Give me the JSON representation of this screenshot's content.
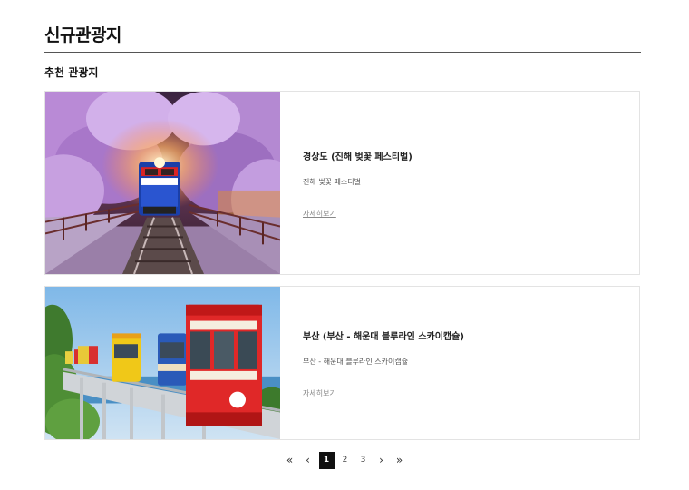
{
  "page": {
    "title": "신규관광지",
    "section_title": "추천 관광지"
  },
  "cards": [
    {
      "title": "경상도 (진해 벚꽃 페스티벌)",
      "description": "진해 벚꽃 페스티벌",
      "more_label": "자세히보기",
      "image": "train-under-cherry-blossoms"
    },
    {
      "title": "부산 (부산 - 해운대 블루라인 스카이캡슐)",
      "description": "부산 - 해운대 블루라인 스카이캡슐",
      "more_label": "자세히보기",
      "image": "colorful-sky-capsules-by-sea"
    }
  ],
  "pagination": {
    "first_icon": "double-chevron-left-icon",
    "prev_icon": "chevron-left-icon",
    "next_icon": "chevron-right-icon",
    "last_icon": "double-chevron-right-icon",
    "first_glyph": "«",
    "prev_glyph": "‹",
    "next_glyph": "›",
    "last_glyph": "»",
    "pages": [
      "1",
      "2",
      "3"
    ],
    "current": "1"
  },
  "colors": {
    "active_page_bg": "#111111",
    "title_rule": "#555555",
    "card_border": "#e3e3e3"
  }
}
